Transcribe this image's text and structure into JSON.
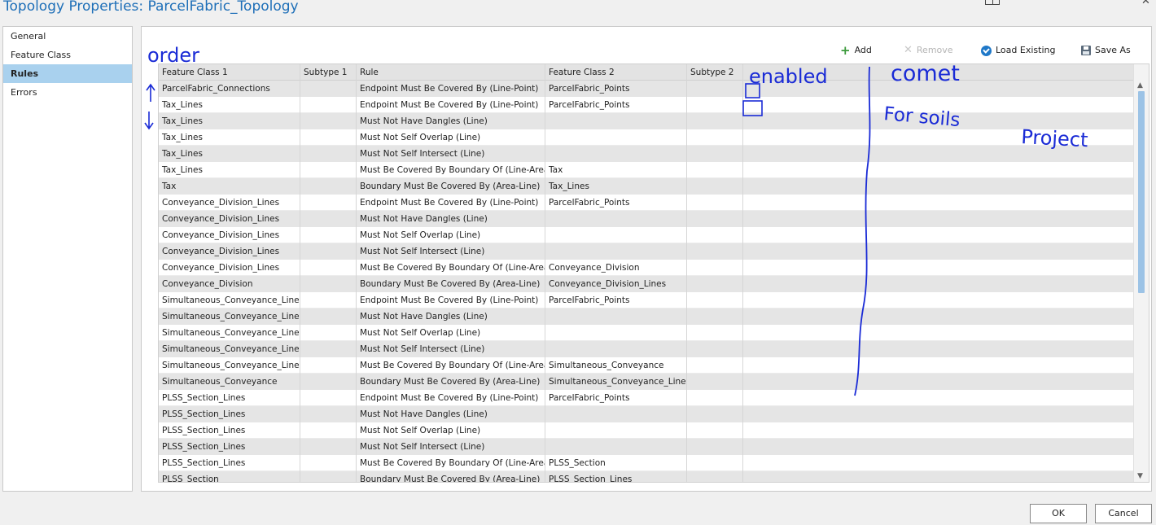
{
  "window": {
    "title": "Topology Properties: ParcelFabric_Topology"
  },
  "nav": {
    "items": [
      {
        "label": "General",
        "active": false
      },
      {
        "label": "Feature Class",
        "active": false
      },
      {
        "label": "Rules",
        "active": true
      },
      {
        "label": "Errors",
        "active": false
      }
    ]
  },
  "toolbar": {
    "add_label": "Add",
    "remove_label": "Remove",
    "load_label": "Load Existing",
    "save_as_label": "Save As"
  },
  "table": {
    "columns": [
      "Feature Class 1",
      "Subtype 1",
      "Rule",
      "Feature Class 2",
      "Subtype 2"
    ],
    "rows": [
      [
        "ParcelFabric_Connections",
        "",
        "Endpoint Must Be Covered By (Line-Point)",
        "ParcelFabric_Points",
        ""
      ],
      [
        "Tax_Lines",
        "",
        "Endpoint Must Be Covered By (Line-Point)",
        "ParcelFabric_Points",
        ""
      ],
      [
        "Tax_Lines",
        "",
        "Must Not Have Dangles (Line)",
        "",
        ""
      ],
      [
        "Tax_Lines",
        "",
        "Must Not Self Overlap (Line)",
        "",
        ""
      ],
      [
        "Tax_Lines",
        "",
        "Must Not Self Intersect (Line)",
        "",
        ""
      ],
      [
        "Tax_Lines",
        "",
        "Must Be Covered By Boundary Of (Line-Area)",
        "Tax",
        ""
      ],
      [
        "Tax",
        "",
        "Boundary Must Be Covered By (Area-Line)",
        "Tax_Lines",
        ""
      ],
      [
        "Conveyance_Division_Lines",
        "",
        "Endpoint Must Be Covered By (Line-Point)",
        "ParcelFabric_Points",
        ""
      ],
      [
        "Conveyance_Division_Lines",
        "",
        "Must Not Have Dangles (Line)",
        "",
        ""
      ],
      [
        "Conveyance_Division_Lines",
        "",
        "Must Not Self Overlap (Line)",
        "",
        ""
      ],
      [
        "Conveyance_Division_Lines",
        "",
        "Must Not Self Intersect (Line)",
        "",
        ""
      ],
      [
        "Conveyance_Division_Lines",
        "",
        "Must Be Covered By Boundary Of (Line-Area)",
        "Conveyance_Division",
        ""
      ],
      [
        "Conveyance_Division",
        "",
        "Boundary Must Be Covered By (Area-Line)",
        "Conveyance_Division_Lines",
        ""
      ],
      [
        "Simultaneous_Conveyance_Lines",
        "",
        "Endpoint Must Be Covered By (Line-Point)",
        "ParcelFabric_Points",
        ""
      ],
      [
        "Simultaneous_Conveyance_Lines",
        "",
        "Must Not Have Dangles (Line)",
        "",
        ""
      ],
      [
        "Simultaneous_Conveyance_Lines",
        "",
        "Must Not Self Overlap (Line)",
        "",
        ""
      ],
      [
        "Simultaneous_Conveyance_Lines",
        "",
        "Must Not Self Intersect (Line)",
        "",
        ""
      ],
      [
        "Simultaneous_Conveyance_Lines",
        "",
        "Must Be Covered By Boundary Of (Line-Area)",
        "Simultaneous_Conveyance",
        ""
      ],
      [
        "Simultaneous_Conveyance",
        "",
        "Boundary Must Be Covered By (Area-Line)",
        "Simultaneous_Conveyance_Lines",
        ""
      ],
      [
        "PLSS_Section_Lines",
        "",
        "Endpoint Must Be Covered By (Line-Point)",
        "ParcelFabric_Points",
        ""
      ],
      [
        "PLSS_Section_Lines",
        "",
        "Must Not Have Dangles (Line)",
        "",
        ""
      ],
      [
        "PLSS_Section_Lines",
        "",
        "Must Not Self Overlap (Line)",
        "",
        ""
      ],
      [
        "PLSS_Section_Lines",
        "",
        "Must Not Self Intersect (Line)",
        "",
        ""
      ],
      [
        "PLSS_Section_Lines",
        "",
        "Must Be Covered By Boundary Of (Line-Area)",
        "PLSS_Section",
        ""
      ],
      [
        "PLSS_Section",
        "",
        "Boundary Must Be Covered By (Area-Line)",
        "PLSS_Section_Lines",
        ""
      ]
    ]
  },
  "annotations": {
    "order": "order",
    "enabled": "enabled",
    "comment": "comet",
    "note_1": "For soils",
    "note_2": "Project"
  },
  "buttons": {
    "ok_label": "OK",
    "cancel_label": "Cancel"
  },
  "colors": {
    "title": "#1e6fb8",
    "selected_nav": "#a9d1ee",
    "ink": "#1a2bd6"
  }
}
